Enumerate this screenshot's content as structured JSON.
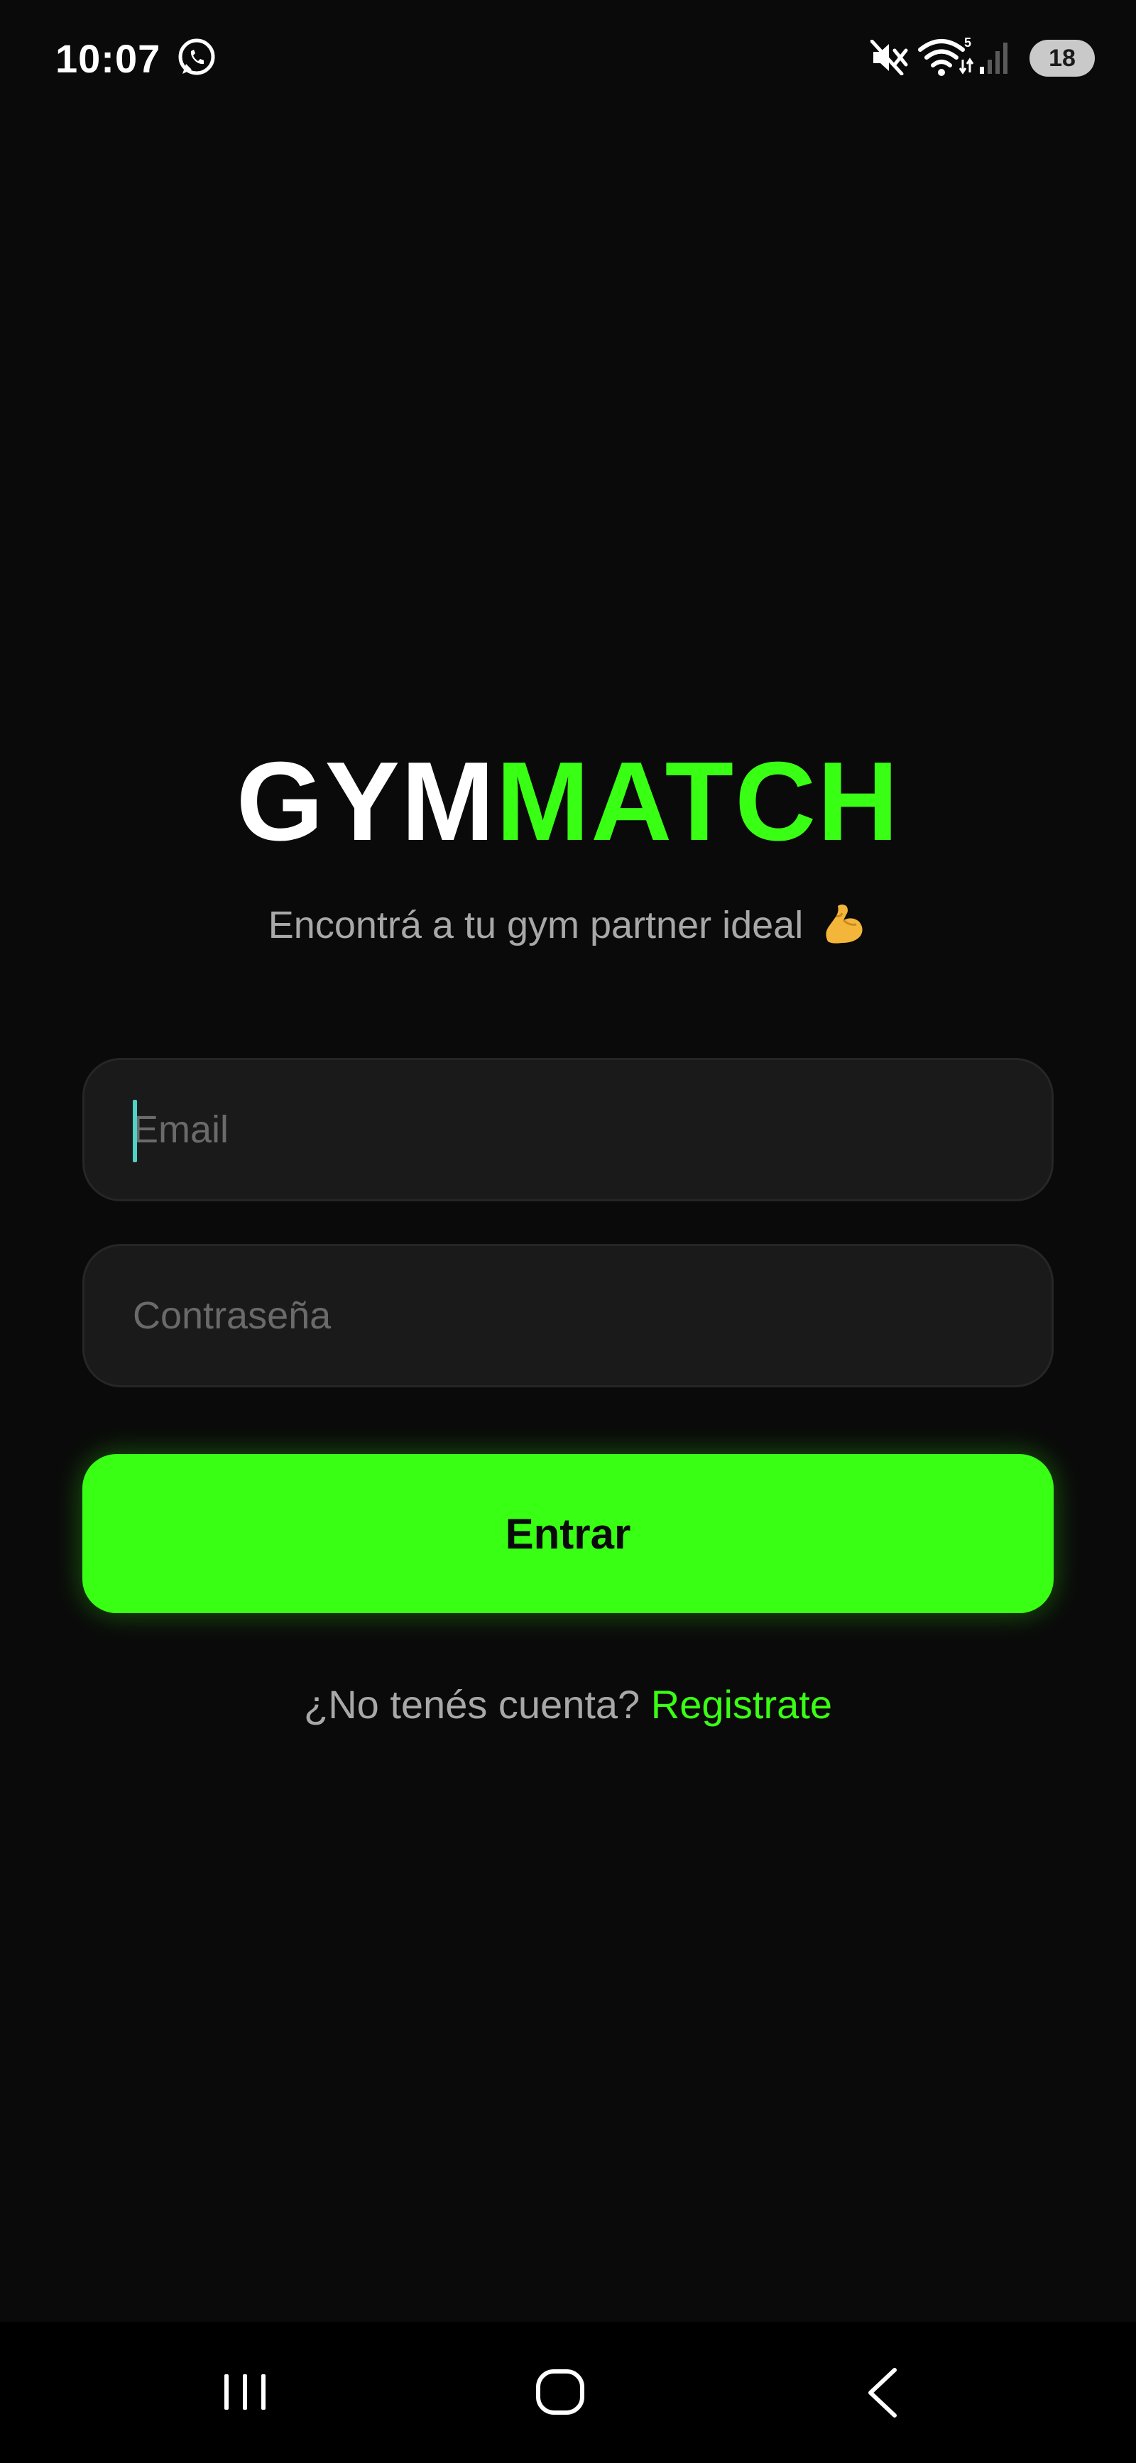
{
  "status_bar": {
    "time": "10:07",
    "battery": "18",
    "icons": [
      "whatsapp-icon",
      "mute-icon",
      "wifi-icon",
      "signal-icon"
    ]
  },
  "logo": {
    "part1": "GYM",
    "part2": "MATCH"
  },
  "tagline": {
    "text": "Encontrá a tu gym partner ideal",
    "emoji_icon": "flexed-biceps-icon"
  },
  "form": {
    "email_placeholder": "Email",
    "email_value": "",
    "password_placeholder": "Contraseña",
    "password_value": "",
    "submit_label": "Entrar"
  },
  "register": {
    "prompt": "¿No tenés cuenta?",
    "link_label": "Registrate"
  },
  "nav_bar": {
    "icons": [
      "recents-icon",
      "home-icon",
      "back-icon"
    ]
  },
  "colors": {
    "background": "#0a0a0a",
    "accent": "#39ff14",
    "field_background": "#1a1a1a",
    "muted_text": "#a8a8a8"
  }
}
